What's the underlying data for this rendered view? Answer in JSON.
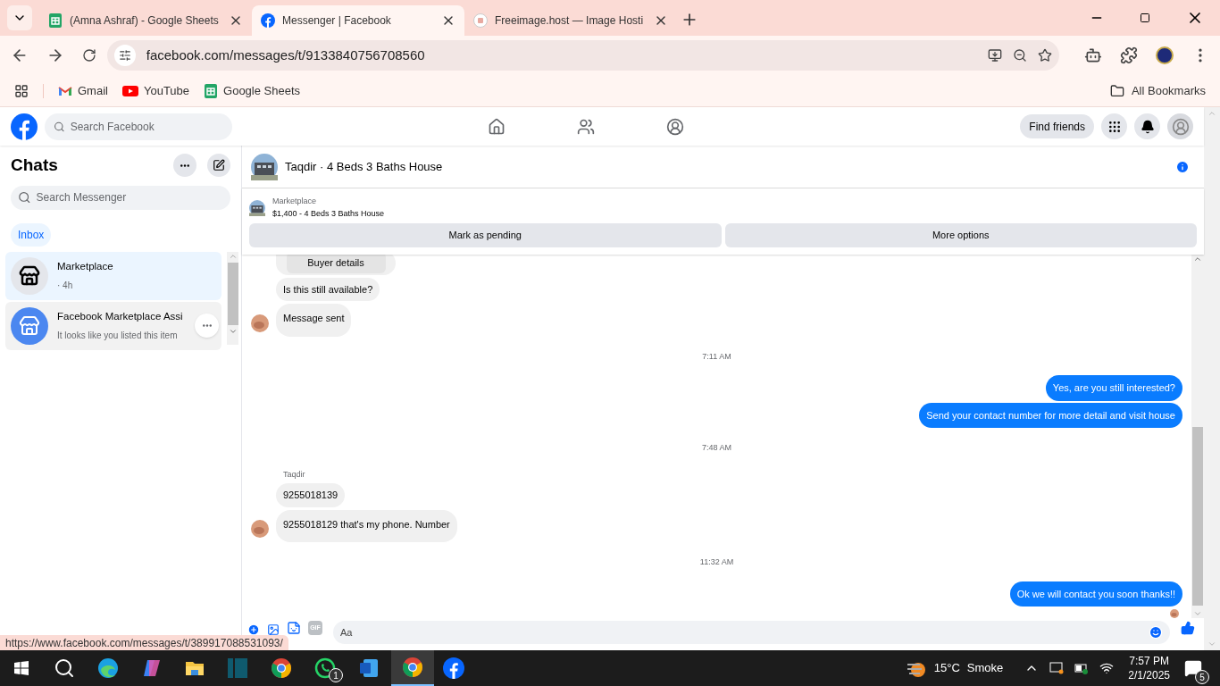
{
  "browser": {
    "tabs": [
      {
        "title": "(Amna Ashraf) - Google Sheets",
        "kind": "sheets",
        "selected": false
      },
      {
        "title": "Messenger | Facebook",
        "kind": "facebook",
        "selected": true
      },
      {
        "title": "Freeimage.host — Image Hosti",
        "kind": "image",
        "selected": false
      }
    ],
    "url": "facebook.com/messages/t/9133840756708560",
    "bookmarks": [
      {
        "label": "Gmail",
        "kind": "gmail"
      },
      {
        "label": "YouTube",
        "kind": "youtube"
      },
      {
        "label": "Google Sheets",
        "kind": "sheets"
      }
    ],
    "all_bookmarks": "All Bookmarks"
  },
  "header": {
    "search_placeholder": "Search Facebook",
    "find_friends": "Find friends"
  },
  "chats": {
    "title": "Chats",
    "search_placeholder": "Search Messenger",
    "filters": [
      {
        "label": "Inbox",
        "selected": true
      }
    ],
    "items": [
      {
        "name": "Marketplace",
        "preview": "· 4h",
        "kind": "marketplace",
        "selected": true
      },
      {
        "name": "Facebook Marketplace Assi",
        "preview": "It looks like you listed this item",
        "kind": "assistant",
        "selected": false
      }
    ]
  },
  "conversation": {
    "title": "Taqdir · 4 Beds 3 Baths House",
    "listing": {
      "label": "Marketplace",
      "title": "$1,400 - 4 Beds 3 Baths House"
    },
    "actions": [
      "Mark as pending",
      "More options"
    ],
    "messages": [
      {
        "kind": "card",
        "text": "Buyer details"
      },
      {
        "kind": "incoming",
        "text": "Is this still available?",
        "avatar": false
      },
      {
        "kind": "incoming",
        "text": "Message sent",
        "avatar": true
      },
      {
        "kind": "time",
        "text": "7:11 AM"
      },
      {
        "kind": "outgoing",
        "text": "Yes, are you still interested?"
      },
      {
        "kind": "outgoing",
        "text": "Send your contact number for more detail and visit house"
      },
      {
        "kind": "time",
        "text": "7:48 AM"
      },
      {
        "kind": "sender",
        "text": "Taqdir"
      },
      {
        "kind": "incoming",
        "text": "9255018139",
        "avatar": false
      },
      {
        "kind": "incoming",
        "text": "9255018129 that's my phone. Number",
        "avatar": true
      },
      {
        "kind": "time",
        "text": "11:32 AM"
      },
      {
        "kind": "outgoing",
        "text": "Ok we will contact you soon thanks!!"
      }
    ],
    "composer_placeholder": "Aa",
    "gif": "GIF"
  },
  "status_url": "https://www.facebook.com/messages/t/389917088531093/",
  "taskbar": {
    "whatsapp_badge": "1",
    "temperature": "15°C",
    "weather": "Smoke",
    "time": "7:57 PM",
    "date": "2/1/2025",
    "notifications": "5"
  }
}
